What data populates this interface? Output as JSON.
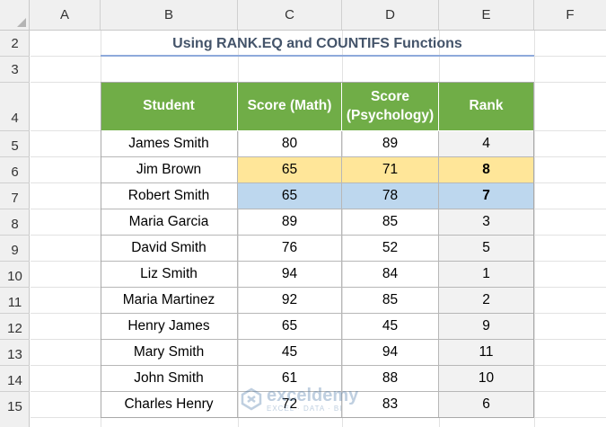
{
  "columns": [
    "A",
    "B",
    "C",
    "D",
    "E",
    "F"
  ],
  "rows": [
    "2",
    "3",
    "4",
    "5",
    "6",
    "7",
    "8",
    "9",
    "10",
    "11",
    "12",
    "13",
    "14",
    "15"
  ],
  "title": "Using RANK.EQ and COUNTIFS Functions",
  "table": {
    "headers": [
      "Student",
      "Score (Math)",
      "Score\n(Psychology)",
      "Rank"
    ],
    "rows": [
      [
        "James Smith",
        "80",
        "89",
        "4"
      ],
      [
        "Jim Brown",
        "65",
        "71",
        "8"
      ],
      [
        "Robert Smith",
        "65",
        "78",
        "7"
      ],
      [
        "Maria Garcia",
        "89",
        "85",
        "3"
      ],
      [
        "David Smith",
        "76",
        "52",
        "5"
      ],
      [
        "Liz Smith",
        "94",
        "84",
        "1"
      ],
      [
        "Maria Martinez",
        "92",
        "85",
        "2"
      ],
      [
        "Henry James",
        "65",
        "45",
        "9"
      ],
      [
        "Mary Smith",
        "45",
        "94",
        "11"
      ],
      [
        "John Smith",
        "61",
        "88",
        "10"
      ],
      [
        "Charles Henry",
        "72",
        "83",
        "6"
      ]
    ]
  },
  "highlights": {
    "yellow": "#ffe699",
    "blue": "#bdd7ee",
    "header_green": "#70ad47"
  },
  "watermark": {
    "name": "exceldemy",
    "tagline": "EXCEL · DATA · BI"
  }
}
